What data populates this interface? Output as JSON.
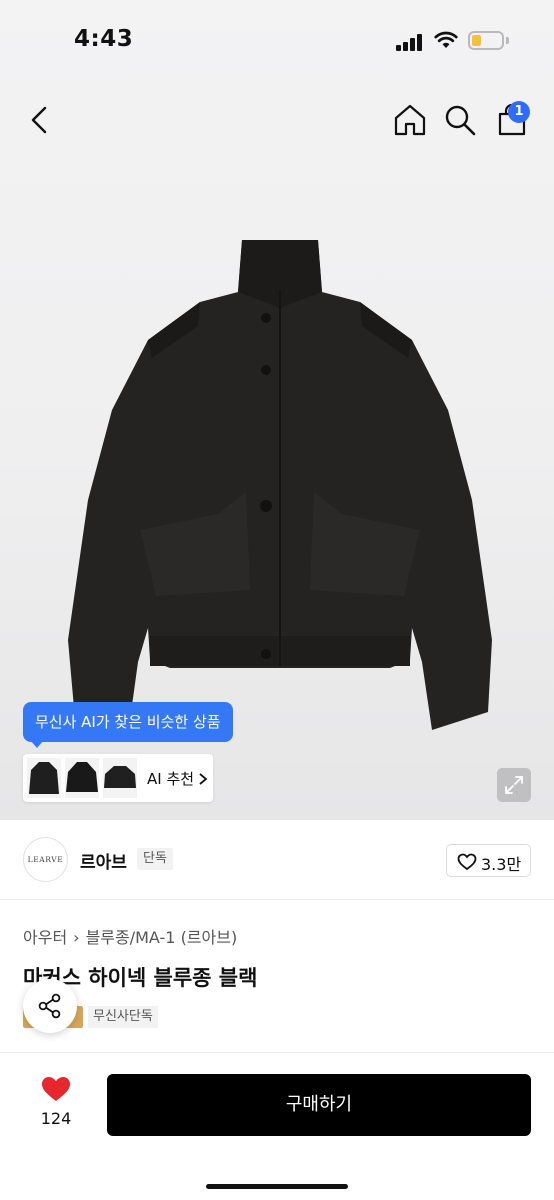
{
  "status_bar": {
    "time": "4:43"
  },
  "header": {
    "back_icon": "chevron-left-icon",
    "home_icon": "home-icon",
    "search_icon": "search-icon",
    "cart_icon": "shopping-bag-icon",
    "cart_badge": "1"
  },
  "ai_recommend": {
    "tooltip": "무신사 AI가 찾은 비슷한 상품",
    "label": "AI 추천"
  },
  "brand": {
    "logo_text": "LEARVE",
    "name": "르아브",
    "badge": "단독",
    "likes": "3.3만"
  },
  "product": {
    "breadcrumb": [
      "아우터",
      "블루종/MA-1 (르아브)"
    ],
    "title": "마커스 하이넥 블루종 블랙",
    "tag": "무신사단독"
  },
  "bottom_bar": {
    "wish_count": "124",
    "buy_label": "구매하기"
  },
  "colors": {
    "accent_blue": "#3578f6",
    "badge_blue": "#2f6bff",
    "heart_red": "#e8262e",
    "buy_button": "#000000"
  }
}
